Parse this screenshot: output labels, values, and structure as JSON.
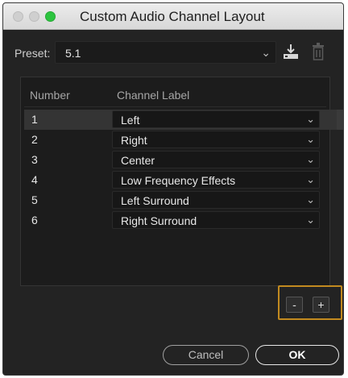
{
  "window": {
    "title": "Custom Audio Channel Layout"
  },
  "preset": {
    "label": "Preset:",
    "value": "5.1",
    "save_icon": "save-preset-icon",
    "delete_icon": "trash-icon"
  },
  "table": {
    "headers": {
      "number": "Number",
      "label": "Channel Label"
    },
    "rows": [
      {
        "number": "1",
        "label": "Left"
      },
      {
        "number": "2",
        "label": "Right"
      },
      {
        "number": "3",
        "label": "Center"
      },
      {
        "number": "4",
        "label": "Low Frequency Effects"
      },
      {
        "number": "5",
        "label": "Left Surround"
      },
      {
        "number": "6",
        "label": "Right Surround"
      }
    ],
    "selected_row": 1
  },
  "controls": {
    "remove_label": "-",
    "add_label": "+"
  },
  "footer": {
    "cancel_label": "Cancel",
    "ok_label": "OK"
  },
  "colors": {
    "accent_highlight": "#c28a1f",
    "zoom_button": "#2cc43f",
    "background": "#232323"
  }
}
